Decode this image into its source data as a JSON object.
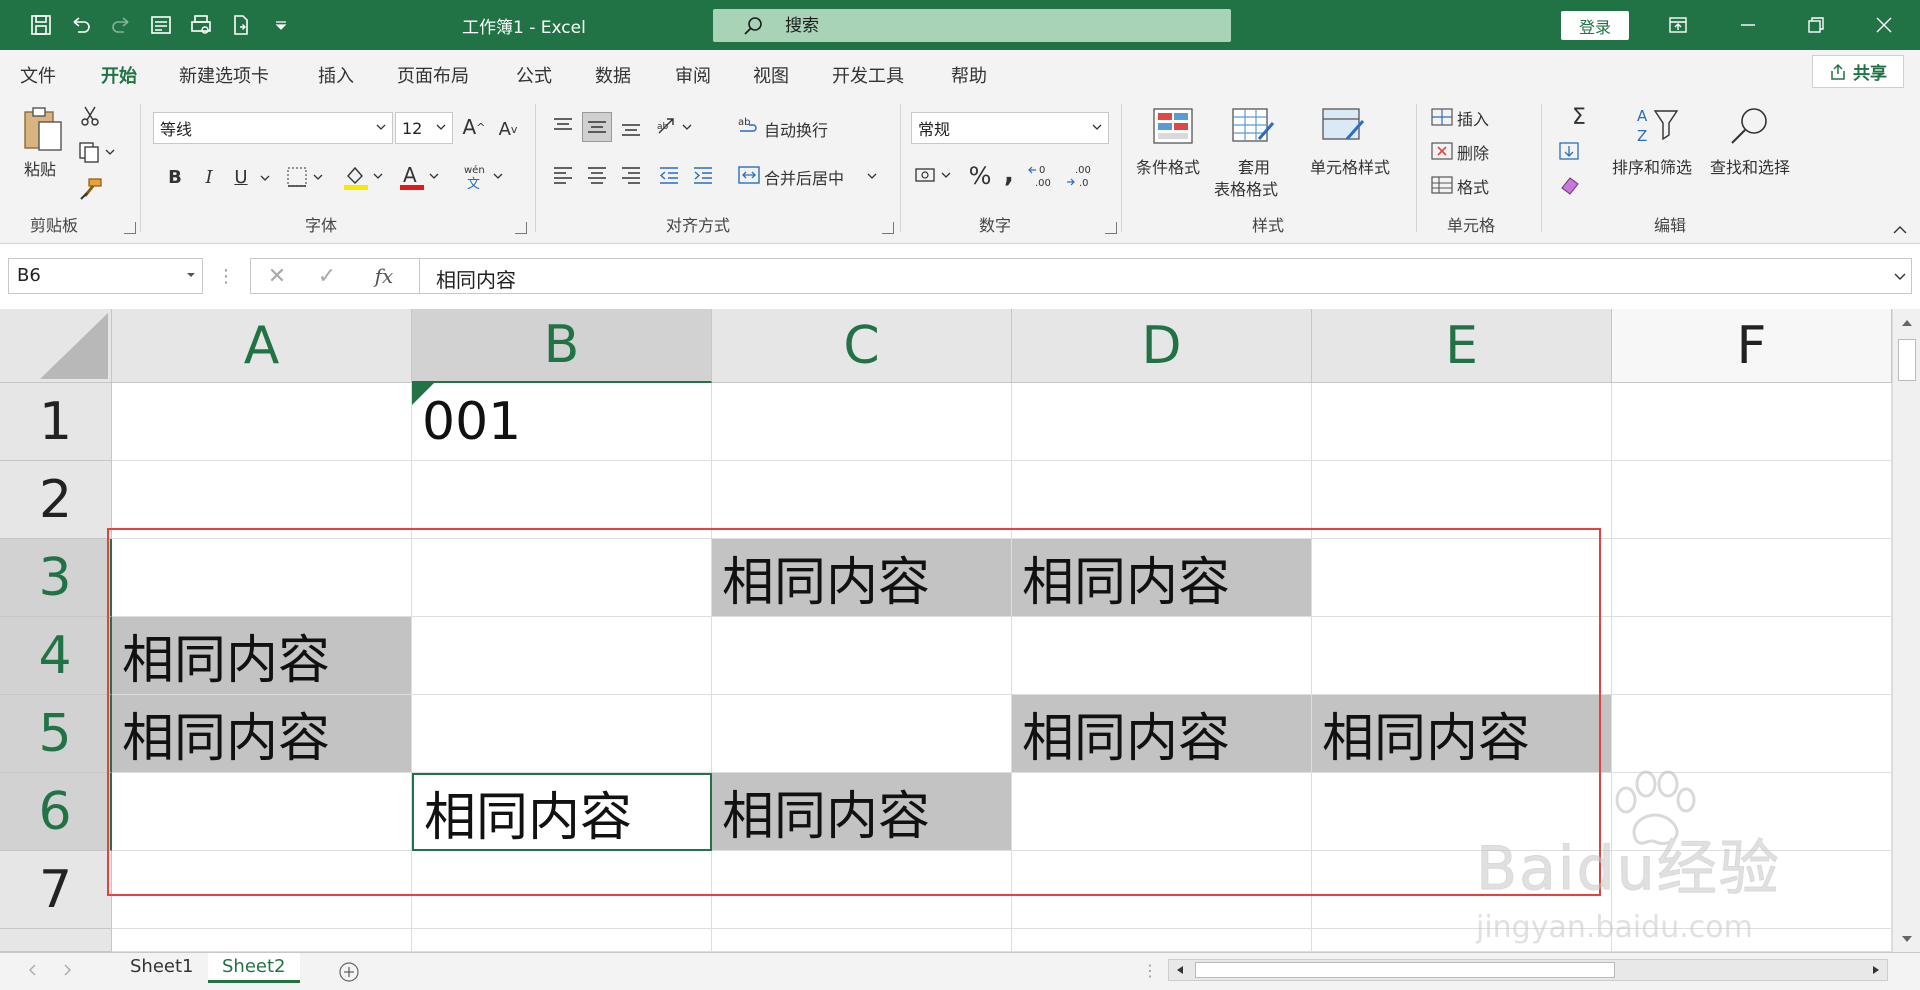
{
  "window": {
    "title": "工作簿1  -  Excel",
    "login_label": "登录"
  },
  "search": {
    "placeholder": "搜索"
  },
  "tabs": [
    "文件",
    "开始",
    "新建选项卡",
    "插入",
    "页面布局",
    "公式",
    "数据",
    "审阅",
    "视图",
    "开发工具",
    "帮助"
  ],
  "active_tab": "开始",
  "share_label": "共享",
  "ribbon": {
    "clipboard": {
      "paste_label": "粘贴",
      "group_label": "剪贴板"
    },
    "font": {
      "font_name": "等线",
      "font_size": "12",
      "group_label": "字体",
      "bold": "B",
      "italic": "I",
      "underline": "U"
    },
    "alignment": {
      "wrap_label": "自动换行",
      "merge_label": "合并后居中",
      "group_label": "对齐方式"
    },
    "number": {
      "format": "常规",
      "percent": "%",
      "comma": ",",
      "group_label": "数字"
    },
    "styles": {
      "conditional_label": "条件格式",
      "table_label_1": "套用",
      "table_label_2": "表格格式",
      "cell_style_label": "单元格样式",
      "group_label": "样式"
    },
    "cells": {
      "insert_label": "插入",
      "delete_label": "删除",
      "format_label": "格式",
      "group_label": "单元格"
    },
    "editing": {
      "sort_label": "排序和筛选",
      "find_label": "查找和选择",
      "group_label": "编辑"
    }
  },
  "formula_bar": {
    "name_box": "B6",
    "content": "相同内容"
  },
  "grid": {
    "columns": [
      "A",
      "B",
      "C",
      "D",
      "E",
      "F"
    ],
    "rows": [
      "1",
      "2",
      "3",
      "4",
      "5",
      "6",
      "7"
    ],
    "cells": {
      "B1": "001",
      "C3": "相同内容",
      "D3": "相同内容",
      "A4": "相同内容",
      "A5": "相同内容",
      "D5": "相同内容",
      "E5": "相同内容",
      "B6": "相同内容",
      "C6": "相同内容"
    },
    "active_cell": "B6"
  },
  "sheets": [
    "Sheet1",
    "Sheet2"
  ],
  "active_sheet": "Sheet2",
  "watermark": {
    "line1": "Baidu经验",
    "line2": "jingyan.baidu.com"
  },
  "colors": {
    "accent": "#217346",
    "highlight_box": "#e8403e",
    "shaded_cell": "#c3c3c3"
  }
}
